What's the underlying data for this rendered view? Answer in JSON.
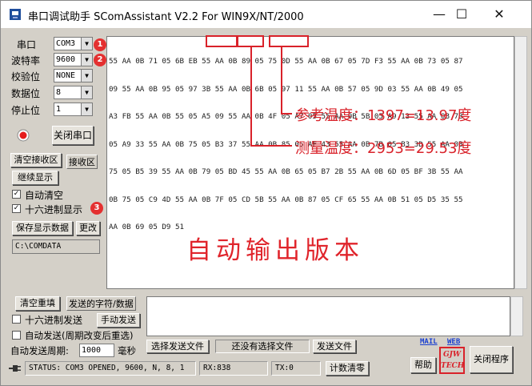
{
  "window": {
    "title": "串口调试助手 SComAssistant V2.2 For WIN9X/NT/2000",
    "controls": {
      "minimize": "—",
      "maximize": "☐",
      "close": "✕"
    }
  },
  "settings": {
    "port_label": "串口",
    "port_value": "COM3",
    "baud_label": "波特率",
    "baud_value": "9600",
    "parity_label": "校验位",
    "parity_value": "NONE",
    "databits_label": "数据位",
    "databits_value": "8",
    "stopbits_label": "停止位",
    "stopbits_value": "1",
    "close_port_button": "关闭串口"
  },
  "receive": {
    "clear_button": "清空接收区",
    "receive_area_label": "接收区",
    "continue_display_button": "继续显示",
    "auto_clear_label": "自动清空",
    "auto_clear_checked": true,
    "hex_display_label": "十六进制显示",
    "hex_display_checked": true,
    "save_data_button": "保存显示数据",
    "change_button": "更改",
    "save_path": "C:\\COMDATA",
    "lines": [
      "55 AA 0B 71 05 6B EB 55 AA 0B 89 05 75 0D 55 AA 0B 67 05 7D F3 55 AA 0B 73 05 87",
      "09 55 AA 0B 95 05 97 3B 55 AA 0B 6B 05 97 11 55 AA 0B 57 05 9D 03 55 AA 0B 49 05",
      "A3 FB 55 AA 0B 55 05 A5 09 55 AA 0B 4F 05 A7 05 55 AA 0B 5B 05 A9 13 55 AA 0B 7B",
      "05 A9 33 55 AA 0B 75 05 B3 37 55 AA 0B 85 05 AF 43 55 AA 0B 7B 05 B3 3D 55 AA 0B",
      "75 05 B5 39 55 AA 0B 79 05 BD 45 55 AA 0B 65 05 B7 2B 55 AA 0B 6D 05 BF 3B 55 AA",
      "0B 75 05 C9 4D 55 AA 0B 7F 05 CD 5B 55 AA 0B 87 05 CF 65 55 AA 0B 51 05 D5 35 55",
      "AA 0B 69 05 D9 51"
    ]
  },
  "annotations": {
    "reference_temp": "参考温度：1397=13.97度",
    "measured_temp": "测量温度：2953=29.53度",
    "auto_output_version": "自动输出版本",
    "badges": [
      "1",
      "2",
      "3"
    ]
  },
  "send": {
    "clear_resend_button": "清空重填",
    "sent_chars_label": "发送的字符/数据",
    "hex_send_label": "十六进制发送",
    "hex_send_checked": false,
    "manual_send_button": "手动发送",
    "auto_send_label": "自动发送(周期改变后重选)",
    "auto_send_checked": false,
    "period_label": "自动发送周期:",
    "period_value": "1000",
    "period_unit": "毫秒",
    "select_file_button": "选择发送文件",
    "no_file_label": "还没有选择文件",
    "send_file_button": "发送文件",
    "mail_link": "MAIL",
    "web_link": "WEB",
    "help_button": "帮助",
    "logo_text": "GJW TECH",
    "close_program_button": "关闭程序"
  },
  "status": {
    "status_text": "STATUS: COM3 OPENED, 9600, N, 8, 1",
    "rx_text": "RX:838",
    "tx_text": "TX:0",
    "count_clear_button": "计数清零"
  },
  "colors": {
    "annotation": "#d9222a",
    "window_bg": "#d4d0c8",
    "link": "#1a3fd0"
  }
}
